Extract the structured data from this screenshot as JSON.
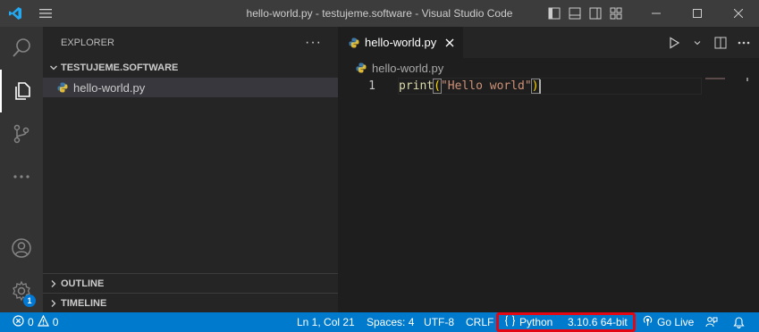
{
  "window": {
    "title": "hello-world.py - testujeme.software - Visual Studio Code",
    "icons": [
      "vscode-logo-icon",
      "hamburger-menu-icon",
      "toggle-primary-sidebar-icon",
      "toggle-panel-icon",
      "toggle-secondary-sidebar-icon",
      "customize-layout-icon",
      "minimize-icon",
      "maximize-icon",
      "close-icon"
    ]
  },
  "activity_bar": {
    "items": [
      "search-icon",
      "explorer-icon",
      "source-control-icon",
      "more-icon",
      "accounts-icon",
      "settings-icon"
    ],
    "settings_badge": "1"
  },
  "sidebar": {
    "header": "EXPLORER",
    "more": "···",
    "folder": "TESTUJEME.SOFTWARE",
    "files": [
      {
        "name": "hello-world.py",
        "icon": "python-file-icon"
      }
    ],
    "outline": "OUTLINE",
    "timeline": "TIMELINE"
  },
  "editor": {
    "tab": {
      "label": "hello-world.py",
      "icon": "python-file-icon"
    },
    "breadcrumb": "hello-world.py",
    "lines": [
      {
        "number": "1",
        "fn": "print",
        "open": "(",
        "str": "\"Hello world\"",
        "close": ")"
      }
    ]
  },
  "status_bar": {
    "problems_errors": "0",
    "problems_warnings": "0",
    "position": "Ln 1, Col 21",
    "indent": "Spaces: 4",
    "encoding": "UTF-8",
    "eol": "CRLF",
    "language": "Python",
    "interpreter": "3.10.6 64-bit",
    "golive": "Go Live"
  },
  "colors": {
    "statusbar": "#007acc",
    "highlight": "#e30613",
    "titlebar": "#3c3c3c",
    "activitybar": "#333333",
    "sidebar": "#252526",
    "editor": "#1e1e1e"
  }
}
